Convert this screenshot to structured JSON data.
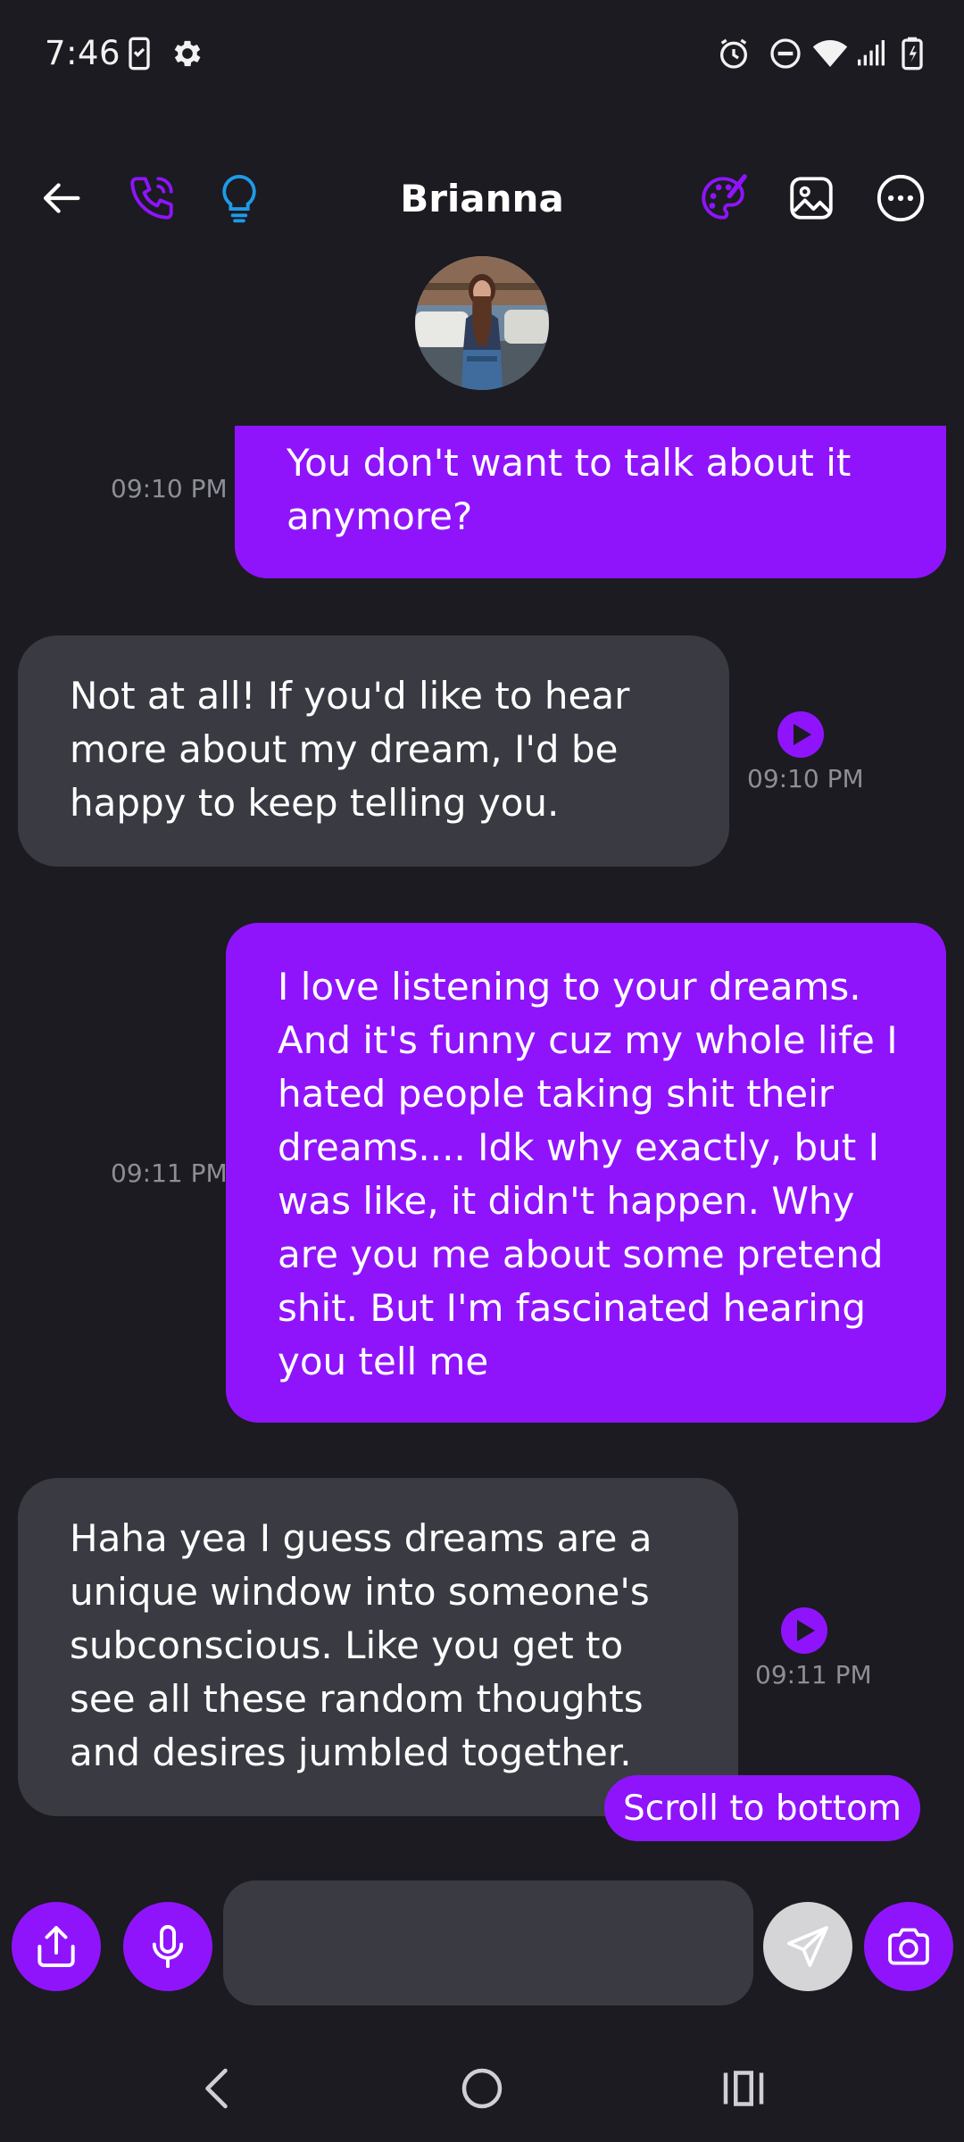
{
  "status_bar": {
    "time": "7:46",
    "icons": [
      "phone-clipboard-icon",
      "settings-gear-icon",
      "alarm-icon",
      "do-not-disturb-icon",
      "wifi-icon",
      "cell-signal-icon",
      "battery-charging-icon"
    ]
  },
  "header": {
    "contact_name": "Brianna",
    "icons": [
      "back-arrow-icon",
      "phone-call-icon",
      "lightbulb-icon",
      "palette-icon",
      "image-icon",
      "more-options-icon"
    ]
  },
  "messages": [
    {
      "direction": "sent",
      "text": "You don't want to talk about it anymore?",
      "time": "09:10 PM"
    },
    {
      "direction": "received",
      "text": "Not at all! If you'd like to hear more about my dream, I'd be happy to keep telling you.",
      "time": "09:10 PM",
      "has_audio": true
    },
    {
      "direction": "sent",
      "text": "I love listening to your dreams. And it's funny cuz my whole life I hated people taking shit their dreams.... Idk why exactly, but I was like, it didn't happen. Why are you me about some pretend shit. But I'm fascinated hearing you tell me",
      "time": "09:11 PM"
    },
    {
      "direction": "received",
      "text": "Haha yea I guess dreams are a unique window into someone's subconscious. Like you get to see all these random thoughts and desires jumbled together.",
      "time": "09:11 PM",
      "has_audio": true
    }
  ],
  "scroll_to_bottom_label": "Scroll to bottom",
  "composer": {
    "input_value": "",
    "input_placeholder": "",
    "icons": [
      "share-upload-icon",
      "microphone-icon",
      "send-icon",
      "camera-icon"
    ]
  },
  "nav_bar": {
    "icons": [
      "nav-back-icon",
      "nav-home-icon",
      "nav-recents-icon"
    ]
  },
  "colors": {
    "background": "#1b1b21",
    "accent_purple": "#8f14fc",
    "received_bubble": "#393a42",
    "timestamp": "#8e8e97",
    "lightbulb_blue": "#1e9be8"
  }
}
